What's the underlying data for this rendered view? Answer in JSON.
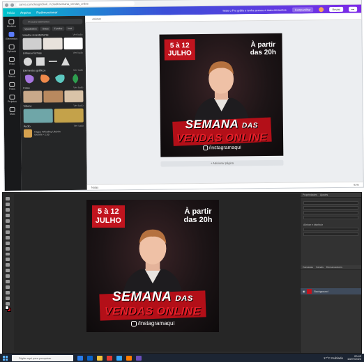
{
  "browser": {
    "url": "canva.com/design/DAF...Kz/edit/semana_vendas_online"
  },
  "canva_header": {
    "home": "Início",
    "file": "Arquivo",
    "resize": "Redimensionar",
    "promo": "Teste o Pro grátis e tenha acesso a mais elementos",
    "share_platform": "Compartilhar",
    "share": "Enviar",
    "more": "•••"
  },
  "rail": [
    {
      "label": "Modelos"
    },
    {
      "label": "Elementos"
    },
    {
      "label": "Uploads"
    },
    {
      "label": "Texto"
    },
    {
      "label": "Marca"
    },
    {
      "label": "Fotos"
    },
    {
      "label": "Projetos"
    },
    {
      "label": "Mais"
    }
  ],
  "panel": {
    "search_placeholder": "Procurar elementos",
    "chips": [
      "Quadrados",
      "Setas",
      "Fundos",
      "Inst"
    ],
    "sections": [
      {
        "title": "Usados recentemente",
        "more": "Ver tudo"
      },
      {
        "title": "Linhas e formas",
        "more": "Ver tudo"
      },
      {
        "title": "Elementos gráficos",
        "more": "Ver tudo"
      },
      {
        "title": "Fotos",
        "more": "Ver tudo"
      },
      {
        "title": "Vídeos",
        "more": "Ver tudo"
      },
      {
        "title": "Áudio",
        "more": "Ver tudo"
      }
    ],
    "audio_title": "Happy Whistling Ukulele",
    "audio_meta": "Ukulele • 2:30"
  },
  "workspace": {
    "toolbar_label": "Animar",
    "add_page": "+ Adicionar página",
    "notes": "Notas",
    "zoom": "41%"
  },
  "poster": {
    "date_line1": "5 à 12",
    "date_line2": "JULHO",
    "time_line1": "À partir",
    "time_line2": "das 20h",
    "title_main": "SEMANA",
    "title_small": "DAS",
    "title_line2": "VENDAS ONLINE",
    "instagram": "/instagramaqui"
  },
  "photoshop": {
    "panel_tabs": [
      "Propriedades",
      "Ajustes"
    ],
    "section_align": "Alinhar e distribuir",
    "layers_tabs": [
      "Camadas",
      "Canais",
      "Demarcadores"
    ],
    "layer_name": "Background"
  },
  "taskbar": {
    "search_placeholder": "Digite aqui para pesquisar",
    "weather": "17°C Nublado",
    "time": "20:43",
    "date": "10/07/2022"
  },
  "colors": {
    "accent_red": "#c0141e",
    "canva_gradient_start": "#00c4cc",
    "canva_gradient_end": "#7d2ae8"
  }
}
